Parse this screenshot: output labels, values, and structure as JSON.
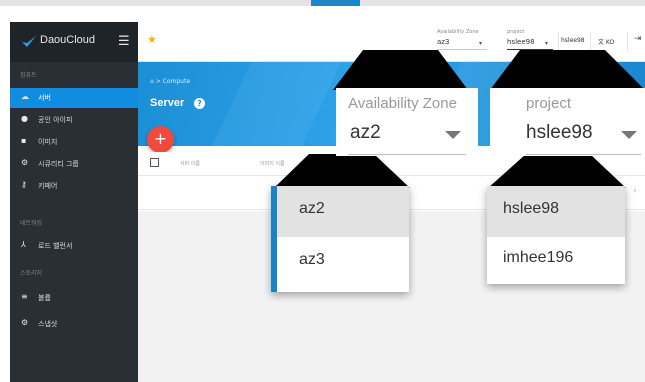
{
  "sidebar": {
    "brand": "DaouCloud",
    "menu_icon": "☰",
    "sections": [
      {
        "label": "컴퓨트"
      },
      {
        "label": "네트워킹"
      },
      {
        "label": "스토리지"
      }
    ],
    "items": [
      {
        "label": "서버",
        "icon": "cloud-icon",
        "active": true
      },
      {
        "label": "공인 아이피",
        "icon": "globe-icon"
      },
      {
        "label": "이미지",
        "icon": "image-icon"
      },
      {
        "label": "시큐리티 그룹",
        "icon": "gear-icon"
      },
      {
        "label": "키페어",
        "icon": "key-icon"
      },
      {
        "label": "로드 밸런서",
        "icon": "balancer-icon"
      },
      {
        "label": "볼륨",
        "icon": "list-icon"
      },
      {
        "label": "스냅샷",
        "icon": "gear-icon"
      }
    ]
  },
  "header": {
    "star_icon": "★",
    "zone_label": "Availability Zone",
    "zone_value": "az3",
    "project_label": "project",
    "project_value": "hslee98",
    "user": "hslee98",
    "lang": "KO",
    "lang_icon": "translate-icon",
    "logout_icon": "logout-icon"
  },
  "content": {
    "breadcrumb": "⌂ > Compute",
    "title": "Server",
    "help": "?",
    "fab": "+",
    "columns": [
      "서버 이름",
      "이미지 이름"
    ]
  },
  "zoom": {
    "zone_label": "Availability Zone",
    "zone_value": "az2",
    "project_label": "project",
    "project_value": "hslee98",
    "zone_options": [
      "az2",
      "az3"
    ],
    "project_options": [
      "hslee98",
      "imhee196"
    ]
  },
  "colors": {
    "sidebar": "#2a2e35",
    "active": "#0f8de0",
    "hero": "#1a8fd6",
    "fab": "#f04a3e",
    "star": "#f2b01e"
  }
}
